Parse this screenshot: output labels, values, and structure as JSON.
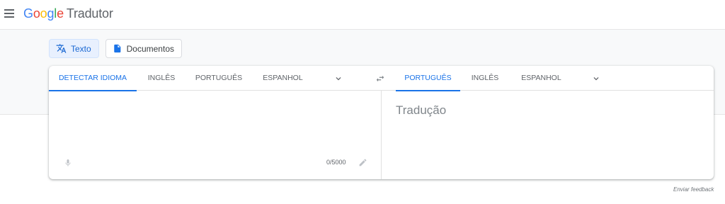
{
  "header": {
    "logo_letters": [
      "G",
      "o",
      "o",
      "g",
      "l",
      "e"
    ],
    "product": "Tradutor"
  },
  "modes": {
    "text_label": "Texto",
    "documents_label": "Documentos"
  },
  "source": {
    "tabs": [
      "DETECTAR IDIOMA",
      "INGLÊS",
      "PORTUGUÊS",
      "ESPANHOL"
    ],
    "active_tab": 0,
    "char_count": "0/5000"
  },
  "target": {
    "tabs": [
      "PORTUGUÊS",
      "INGLÊS",
      "ESPANHOL"
    ],
    "active_tab": 0,
    "placeholder": "Tradução"
  },
  "footer": {
    "feedback": "Enviar feedback"
  },
  "colors": {
    "accent": "#1a73e8",
    "active_mode_bg": "#e8f0fe",
    "band_bg": "#f8f9fa"
  },
  "icons": [
    "menu-icon",
    "translate-icon",
    "document-icon",
    "chevron-down-icon",
    "swap-icon",
    "mic-icon",
    "pencil-icon"
  ]
}
